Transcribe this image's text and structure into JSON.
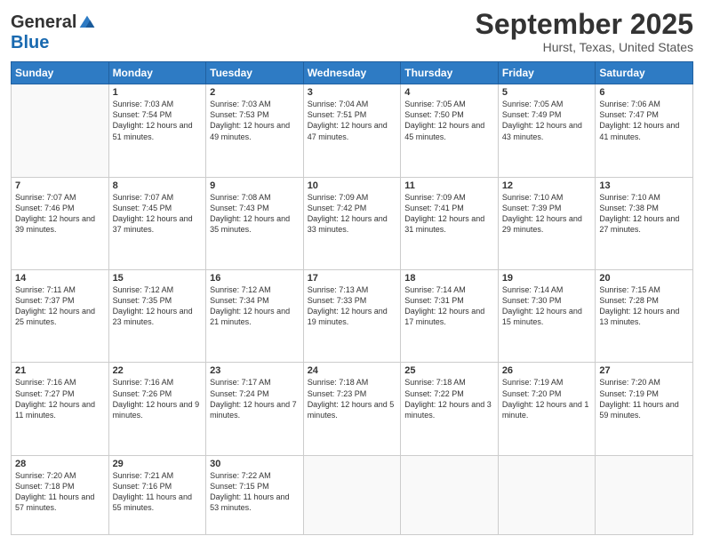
{
  "logo": {
    "general": "General",
    "blue": "Blue"
  },
  "title": "September 2025",
  "location": "Hurst, Texas, United States",
  "days_header": [
    "Sunday",
    "Monday",
    "Tuesday",
    "Wednesday",
    "Thursday",
    "Friday",
    "Saturday"
  ],
  "weeks": [
    [
      {
        "day": "",
        "sunrise": "",
        "sunset": "",
        "daylight": ""
      },
      {
        "day": "1",
        "sunrise": "Sunrise: 7:03 AM",
        "sunset": "Sunset: 7:54 PM",
        "daylight": "Daylight: 12 hours and 51 minutes."
      },
      {
        "day": "2",
        "sunrise": "Sunrise: 7:03 AM",
        "sunset": "Sunset: 7:53 PM",
        "daylight": "Daylight: 12 hours and 49 minutes."
      },
      {
        "day": "3",
        "sunrise": "Sunrise: 7:04 AM",
        "sunset": "Sunset: 7:51 PM",
        "daylight": "Daylight: 12 hours and 47 minutes."
      },
      {
        "day": "4",
        "sunrise": "Sunrise: 7:05 AM",
        "sunset": "Sunset: 7:50 PM",
        "daylight": "Daylight: 12 hours and 45 minutes."
      },
      {
        "day": "5",
        "sunrise": "Sunrise: 7:05 AM",
        "sunset": "Sunset: 7:49 PM",
        "daylight": "Daylight: 12 hours and 43 minutes."
      },
      {
        "day": "6",
        "sunrise": "Sunrise: 7:06 AM",
        "sunset": "Sunset: 7:47 PM",
        "daylight": "Daylight: 12 hours and 41 minutes."
      }
    ],
    [
      {
        "day": "7",
        "sunrise": "Sunrise: 7:07 AM",
        "sunset": "Sunset: 7:46 PM",
        "daylight": "Daylight: 12 hours and 39 minutes."
      },
      {
        "day": "8",
        "sunrise": "Sunrise: 7:07 AM",
        "sunset": "Sunset: 7:45 PM",
        "daylight": "Daylight: 12 hours and 37 minutes."
      },
      {
        "day": "9",
        "sunrise": "Sunrise: 7:08 AM",
        "sunset": "Sunset: 7:43 PM",
        "daylight": "Daylight: 12 hours and 35 minutes."
      },
      {
        "day": "10",
        "sunrise": "Sunrise: 7:09 AM",
        "sunset": "Sunset: 7:42 PM",
        "daylight": "Daylight: 12 hours and 33 minutes."
      },
      {
        "day": "11",
        "sunrise": "Sunrise: 7:09 AM",
        "sunset": "Sunset: 7:41 PM",
        "daylight": "Daylight: 12 hours and 31 minutes."
      },
      {
        "day": "12",
        "sunrise": "Sunrise: 7:10 AM",
        "sunset": "Sunset: 7:39 PM",
        "daylight": "Daylight: 12 hours and 29 minutes."
      },
      {
        "day": "13",
        "sunrise": "Sunrise: 7:10 AM",
        "sunset": "Sunset: 7:38 PM",
        "daylight": "Daylight: 12 hours and 27 minutes."
      }
    ],
    [
      {
        "day": "14",
        "sunrise": "Sunrise: 7:11 AM",
        "sunset": "Sunset: 7:37 PM",
        "daylight": "Daylight: 12 hours and 25 minutes."
      },
      {
        "day": "15",
        "sunrise": "Sunrise: 7:12 AM",
        "sunset": "Sunset: 7:35 PM",
        "daylight": "Daylight: 12 hours and 23 minutes."
      },
      {
        "day": "16",
        "sunrise": "Sunrise: 7:12 AM",
        "sunset": "Sunset: 7:34 PM",
        "daylight": "Daylight: 12 hours and 21 minutes."
      },
      {
        "day": "17",
        "sunrise": "Sunrise: 7:13 AM",
        "sunset": "Sunset: 7:33 PM",
        "daylight": "Daylight: 12 hours and 19 minutes."
      },
      {
        "day": "18",
        "sunrise": "Sunrise: 7:14 AM",
        "sunset": "Sunset: 7:31 PM",
        "daylight": "Daylight: 12 hours and 17 minutes."
      },
      {
        "day": "19",
        "sunrise": "Sunrise: 7:14 AM",
        "sunset": "Sunset: 7:30 PM",
        "daylight": "Daylight: 12 hours and 15 minutes."
      },
      {
        "day": "20",
        "sunrise": "Sunrise: 7:15 AM",
        "sunset": "Sunset: 7:28 PM",
        "daylight": "Daylight: 12 hours and 13 minutes."
      }
    ],
    [
      {
        "day": "21",
        "sunrise": "Sunrise: 7:16 AM",
        "sunset": "Sunset: 7:27 PM",
        "daylight": "Daylight: 12 hours and 11 minutes."
      },
      {
        "day": "22",
        "sunrise": "Sunrise: 7:16 AM",
        "sunset": "Sunset: 7:26 PM",
        "daylight": "Daylight: 12 hours and 9 minutes."
      },
      {
        "day": "23",
        "sunrise": "Sunrise: 7:17 AM",
        "sunset": "Sunset: 7:24 PM",
        "daylight": "Daylight: 12 hours and 7 minutes."
      },
      {
        "day": "24",
        "sunrise": "Sunrise: 7:18 AM",
        "sunset": "Sunset: 7:23 PM",
        "daylight": "Daylight: 12 hours and 5 minutes."
      },
      {
        "day": "25",
        "sunrise": "Sunrise: 7:18 AM",
        "sunset": "Sunset: 7:22 PM",
        "daylight": "Daylight: 12 hours and 3 minutes."
      },
      {
        "day": "26",
        "sunrise": "Sunrise: 7:19 AM",
        "sunset": "Sunset: 7:20 PM",
        "daylight": "Daylight: 12 hours and 1 minute."
      },
      {
        "day": "27",
        "sunrise": "Sunrise: 7:20 AM",
        "sunset": "Sunset: 7:19 PM",
        "daylight": "Daylight: 11 hours and 59 minutes."
      }
    ],
    [
      {
        "day": "28",
        "sunrise": "Sunrise: 7:20 AM",
        "sunset": "Sunset: 7:18 PM",
        "daylight": "Daylight: 11 hours and 57 minutes."
      },
      {
        "day": "29",
        "sunrise": "Sunrise: 7:21 AM",
        "sunset": "Sunset: 7:16 PM",
        "daylight": "Daylight: 11 hours and 55 minutes."
      },
      {
        "day": "30",
        "sunrise": "Sunrise: 7:22 AM",
        "sunset": "Sunset: 7:15 PM",
        "daylight": "Daylight: 11 hours and 53 minutes."
      },
      {
        "day": "",
        "sunrise": "",
        "sunset": "",
        "daylight": ""
      },
      {
        "day": "",
        "sunrise": "",
        "sunset": "",
        "daylight": ""
      },
      {
        "day": "",
        "sunrise": "",
        "sunset": "",
        "daylight": ""
      },
      {
        "day": "",
        "sunrise": "",
        "sunset": "",
        "daylight": ""
      }
    ]
  ]
}
